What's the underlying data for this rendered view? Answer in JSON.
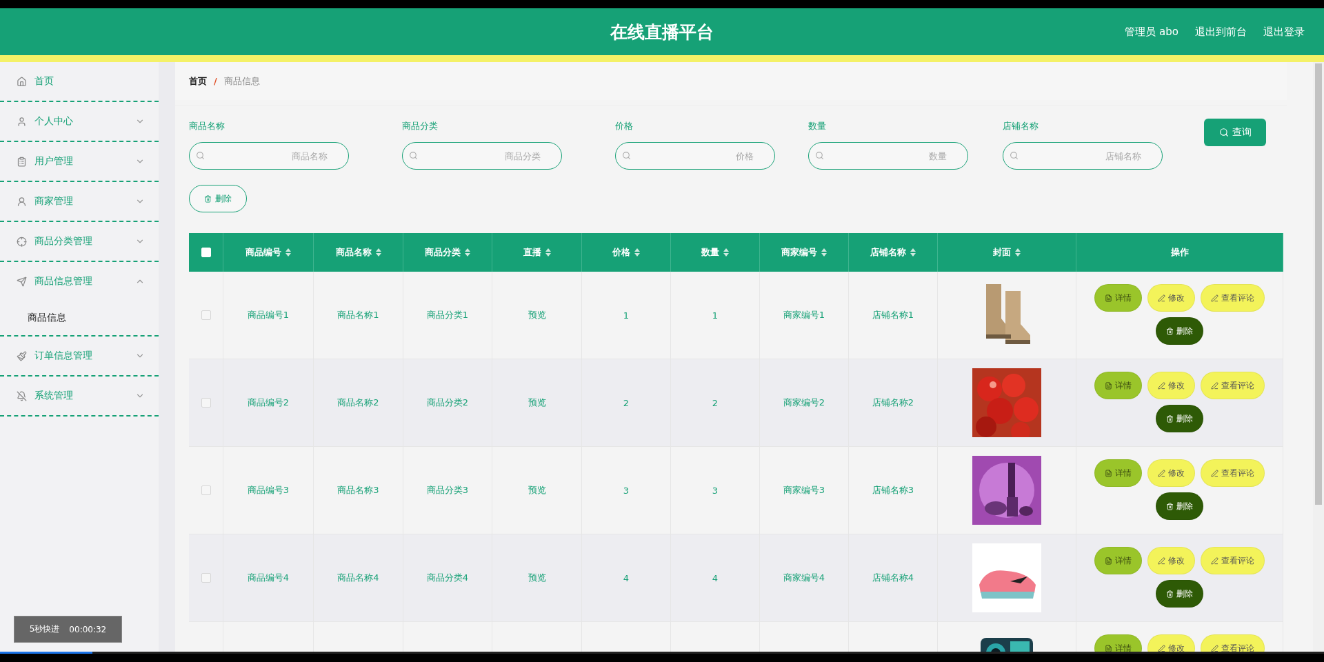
{
  "header": {
    "title": "在线直播平台",
    "links": [
      "管理员 abo",
      "退出到前台",
      "退出登录"
    ]
  },
  "sidebar": {
    "items": [
      {
        "label": "首页",
        "kind": "link"
      },
      {
        "label": "个人中心",
        "kind": "group",
        "expanded": false
      },
      {
        "label": "用户管理",
        "kind": "group",
        "expanded": false
      },
      {
        "label": "商家管理",
        "kind": "group",
        "expanded": false
      },
      {
        "label": "商品分类管理",
        "kind": "group",
        "expanded": false
      },
      {
        "label": "商品信息管理",
        "kind": "group",
        "expanded": true,
        "children": [
          {
            "label": "商品信息"
          }
        ]
      },
      {
        "label": "订单信息管理",
        "kind": "group",
        "expanded": false
      },
      {
        "label": "系统管理",
        "kind": "group",
        "expanded": false
      }
    ]
  },
  "breadcrumb": {
    "items": [
      "首页",
      "商品信息"
    ],
    "separator": "/"
  },
  "filters": [
    {
      "label": "商品名称",
      "placeholder": "商品名称"
    },
    {
      "label": "商品分类",
      "placeholder": "商品分类"
    },
    {
      "label": "价格",
      "placeholder": "价格"
    },
    {
      "label": "数量",
      "placeholder": "数量"
    },
    {
      "label": "店铺名称",
      "placeholder": "店铺名称"
    }
  ],
  "search_button": "查询",
  "delete_button": "删除",
  "table": {
    "all_checked": false,
    "columns": [
      {
        "label": "商品编号",
        "sortable": true
      },
      {
        "label": "商品名称",
        "sortable": true
      },
      {
        "label": "商品分类",
        "sortable": true
      },
      {
        "label": "直播",
        "sortable": true
      },
      {
        "label": "价格",
        "sortable": true
      },
      {
        "label": "数量",
        "sortable": true
      },
      {
        "label": "商家编号",
        "sortable": true
      },
      {
        "label": "店铺名称",
        "sortable": true
      },
      {
        "label": "封面",
        "sortable": true
      },
      {
        "label": "操作",
        "sortable": false
      }
    ],
    "rows": [
      {
        "checked": false,
        "cells": [
          "商品编号1",
          "商品名称1",
          "商品分类1",
          "预览",
          "1",
          "1",
          "商家编号1",
          "店铺名称1"
        ],
        "cover": {
          "kind": "picture"
        },
        "actions": [
          {
            "kind": "detail",
            "label": "详情"
          },
          {
            "kind": "edit",
            "label": "修改"
          },
          {
            "kind": "comments",
            "label": "查看评论"
          },
          {
            "kind": "delete",
            "label": "删除"
          }
        ]
      },
      {
        "checked": false,
        "cells": [
          "商品编号2",
          "商品名称2",
          "商品分类2",
          "预览",
          "2",
          "2",
          "商家编号2",
          "店铺名称2"
        ],
        "cover": {
          "kind": "picture"
        },
        "actions": [
          {
            "kind": "detail",
            "label": "详情"
          },
          {
            "kind": "edit",
            "label": "修改"
          },
          {
            "kind": "comments",
            "label": "查看评论"
          },
          {
            "kind": "delete",
            "label": "删除"
          }
        ]
      },
      {
        "checked": false,
        "cells": [
          "商品编号3",
          "商品名称3",
          "商品分类3",
          "预览",
          "3",
          "3",
          "商家编号3",
          "店铺名称3"
        ],
        "cover": {
          "kind": "picture"
        },
        "actions": [
          {
            "kind": "detail",
            "label": "详情"
          },
          {
            "kind": "edit",
            "label": "修改"
          },
          {
            "kind": "comments",
            "label": "查看评论"
          },
          {
            "kind": "delete",
            "label": "删除"
          }
        ]
      },
      {
        "checked": false,
        "cells": [
          "商品编号4",
          "商品名称4",
          "商品分类4",
          "预览",
          "4",
          "4",
          "商家编号4",
          "店铺名称4"
        ],
        "cover": {
          "kind": "picture"
        },
        "actions": [
          {
            "kind": "detail",
            "label": "详情"
          },
          {
            "kind": "edit",
            "label": "修改"
          },
          {
            "kind": "comments",
            "label": "查看评论"
          },
          {
            "kind": "delete",
            "label": "删除"
          }
        ]
      },
      {
        "cover": {
          "kind": "picture"
        },
        "actions": [
          {
            "kind": "detail",
            "label": "详情"
          },
          {
            "kind": "edit",
            "label": "修改"
          },
          {
            "kind": "comments",
            "label": "查看评论"
          }
        ]
      }
    ]
  },
  "player": {
    "label": "5秒快进",
    "time": "00:00:32",
    "level": 0.07
  }
}
